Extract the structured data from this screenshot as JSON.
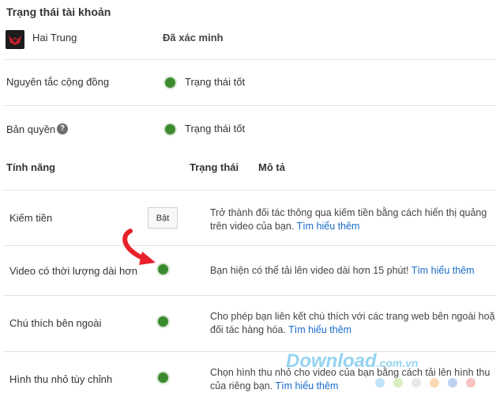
{
  "account_status": {
    "title": "Trạng thái tài khoản",
    "user_name": "Hai Trung",
    "verified_label": "Đã xác minh",
    "rows": [
      {
        "label": "Nguyên tắc cộng đồng",
        "status": "Trạng thái tốt"
      },
      {
        "label": "Bản quyền",
        "status": "Trạng thái tốt",
        "help_icon": "?"
      }
    ]
  },
  "features": {
    "headers": {
      "feature": "Tính năng",
      "status": "Trạng thái",
      "description": "Mô tả"
    },
    "rows": [
      {
        "label": "Kiếm tiền",
        "button_label": "Bật",
        "desc_line1": "Trở thành đối tác thông qua kiếm tiền bằng cách hiển thị quảng",
        "desc_line2": "trên video của bạn.",
        "link": "Tìm hiểu thêm"
      },
      {
        "label": "Video có thời lượng dài hơn",
        "desc_line1": "Bạn hiện có thể tải lên video dài hơn 15 phút!",
        "link": "Tìm hiểu thêm"
      },
      {
        "label": "Chú thích bên ngoài",
        "desc_line1": "Cho phép bạn liên kết chú thích với các trang web bên ngoài hoặ",
        "desc_line2": "đối tác hàng hóa.",
        "link": "Tìm hiểu thêm"
      },
      {
        "label": "Hình thu nhỏ tùy chỉnh",
        "desc_line1": "Chọn hình thu nhỏ cho video của bạn bằng cách tải lên hình thu",
        "desc_line2": "của riêng bạn.",
        "link": "Tìm hiểu thêm"
      }
    ]
  },
  "watermark": {
    "brand": "Download",
    "suffix": ".com.vn"
  },
  "colors": {
    "status_green": "#3c8a30",
    "link_blue": "#1a6bc9",
    "annotation_red": "#e8212a",
    "watermark_blue": "#3db0e6"
  },
  "icons": {
    "status": "green-dot-icon",
    "help": "question-circle-icon",
    "annotation": "curved-arrow-icon"
  }
}
